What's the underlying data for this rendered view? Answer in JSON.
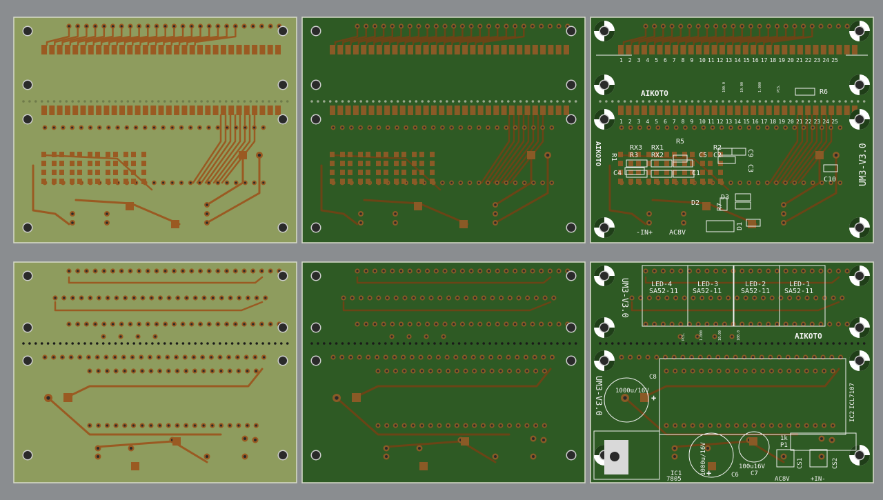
{
  "colors": {
    "background": "#8a8d90",
    "board_light": "#8e9c5e",
    "board_dark": "#2e5a24",
    "copper": "#9a5a22",
    "copper_dark": "#6b4416",
    "hole": "#2a2a2a",
    "silk": "#f2f2f2"
  },
  "boards": [
    {
      "id": "top-copper-light",
      "label": ""
    },
    {
      "id": "top-copper-dark",
      "label": ""
    },
    {
      "id": "top-silkscreen",
      "label": ""
    },
    {
      "id": "bottom-copper-light",
      "label": ""
    },
    {
      "id": "bottom-copper-dark",
      "label": ""
    },
    {
      "id": "bottom-silkscreen",
      "label": ""
    }
  ],
  "silk_top": {
    "pin_numbers": [
      "1",
      "2",
      "3",
      "4",
      "5",
      "6",
      "7",
      "8",
      "9",
      "10",
      "11",
      "12",
      "13",
      "14",
      "15",
      "16",
      "17",
      "18",
      "19",
      "20",
      "21",
      "22",
      "23",
      "24",
      "25"
    ],
    "logo": "AIKOTO",
    "version": "UM3-V3.0",
    "labels": {
      "rx3": "RX3",
      "rx1": "RX1",
      "r3": "R3",
      "rx2": "RX2",
      "r5": "R5",
      "r2": "R2",
      "c2": "C2",
      "c9": "C9",
      "c5": "C5",
      "c4": "C4",
      "c1": "C1",
      "c3": "C3",
      "c10": "C10",
      "r1": "R1",
      "r6": "R6",
      "r7": "R7",
      "d1": "D1",
      "d2": "D2",
      "d3": "D3",
      "in": "-IN+",
      "ac8v": "AC8V"
    },
    "small_values": [
      "100.0",
      "10.00",
      "1.000",
      "PCS."
    ]
  },
  "silk_bottom": {
    "version_a": "UM3-V3.0",
    "version_b": "UM3-V3.0",
    "logo": "AIKOTO",
    "leds": [
      {
        "name": "LED-4",
        "part": "SA52-11"
      },
      {
        "name": "LED-3",
        "part": "SA52-11"
      },
      {
        "name": "LED-2",
        "part": "SA52-11"
      },
      {
        "name": "LED-1",
        "part": "SA52-11"
      }
    ],
    "labels": {
      "c8": "C8",
      "cap_big": "1000u/16V",
      "cap_rot": "1000u/16V",
      "cap_small": "100u16V",
      "c6": "C6",
      "c7": "C7",
      "ic1": "IC1",
      "reg": "7805",
      "ic2": "IC2",
      "icl": "ICL7107",
      "r1k": "1k",
      "p1": "P1",
      "cs1": "CS1",
      "cs2": "CS2",
      "ac8v": "AC8V",
      "in": "+IN-",
      "plus": "+"
    },
    "small_values": [
      "PCS.",
      "1.000",
      "10.00",
      "100.0"
    ]
  }
}
